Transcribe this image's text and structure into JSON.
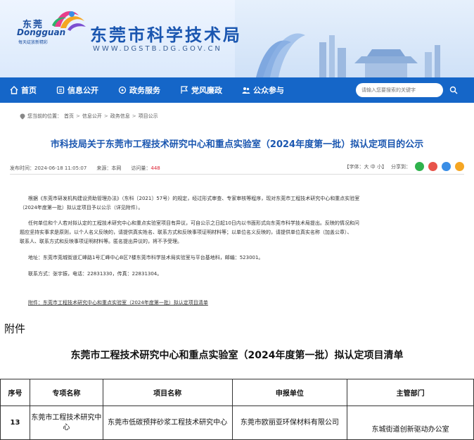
{
  "header": {
    "logo_cn": "东莞",
    "logo_en": "Dongguan",
    "logo_slogan": "每天绽放新精彩",
    "site_title": "东莞市科学技术局",
    "site_url": "WWW.DGSTB.DG.GOV.CN"
  },
  "nav": {
    "items": [
      {
        "label": "首页",
        "icon": "home-icon"
      },
      {
        "label": "信息公开",
        "icon": "info-icon"
      },
      {
        "label": "政务服务",
        "icon": "service-icon"
      },
      {
        "label": "党风廉政",
        "icon": "flag-icon"
      },
      {
        "label": "公众参与",
        "icon": "people-icon"
      }
    ],
    "search_placeholder": "请输入您要搜索的关键字"
  },
  "breadcrumb": {
    "prefix": "您当前的位置：",
    "items": [
      "首页",
      "信息公开",
      "政务信息",
      "项目公示"
    ]
  },
  "article": {
    "title": "市科技局关于东莞市工程技术研究中心和重点实验室（2024年度第一批）拟认定项目的公示",
    "publish_time": "发布时间：2024-06-18 11:05:07",
    "source": "来源：本网",
    "visits_label": "访问量：",
    "visits": "448",
    "font_size_label": "【字体：大 中 小】",
    "share_label": "分享到：",
    "paragraph1_line1": "根据《东莞市研发机构建设资助管理办法》（东科〔2021〕57号）的规定，经过形式审查、专家审核等程序，现对东莞市工程技术研究中心和重点实验室",
    "paragraph1_line2": "（2024年度第一批）拟认定项目予以公示（详见附件）。",
    "paragraph2_line1": "任何单位和个人若对拟认定的工程技术研究中心和重点实验室项目有异议，可自公示之日起10日内以书面形式向东莞市科学技术局提出。反映的情况和问",
    "paragraph2_line2": "题应坚持实事求是原则，以个人名义反映的，请提供真实姓名、联系方式和反映事项证明材料等；以单位名义反映的，请提供单位真实名称（加盖公章）、",
    "paragraph2_line3": "联系人、联系方式和反映事项证明材料等。匿名提出异议的，将不予受理。",
    "address": "地址：东莞市莞城街道汇峰路1号汇峰中心B区7楼东莞市科学技术局实验室与平台基地科，邮编：523001。",
    "contact": "联系方式：张宇振，电话：22831330，传真：22831304。",
    "attachment_link": "附件：东莞市工程技术研究中心和重点实验室（2024年度第一批）拟认定项目清单"
  },
  "attachment": {
    "heading": "附件",
    "list_title": "东莞市工程技术研究中心和重点实验室（2024年度第一批）拟认定项目清单",
    "columns": [
      "序号",
      "专项名称",
      "项目名称",
      "申报单位",
      "主管部门"
    ],
    "rows": [
      {
        "index": "13",
        "category": "东莞市工程技术研究中心",
        "project": "东莞市低碳预拌砂浆工程技术研究中心",
        "applicant": "东莞市欧丽亚环保材料有限公司",
        "department": "东城街道创新驱动办公室"
      }
    ]
  },
  "colors": {
    "brand_blue": "#1566c8",
    "title_blue": "#1a56b0",
    "visits_red": "#dd2233"
  }
}
